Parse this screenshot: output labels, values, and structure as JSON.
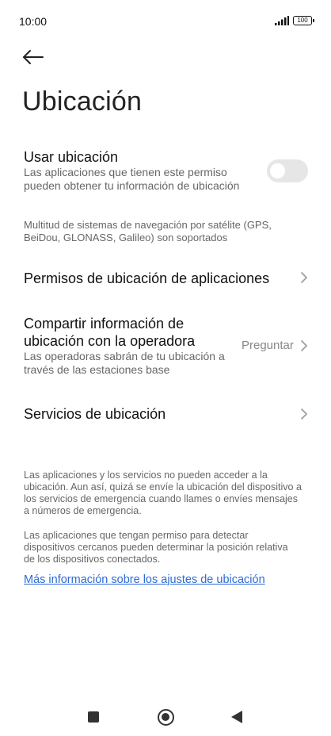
{
  "status_bar": {
    "time": "10:00",
    "battery": "100",
    "icons": [
      "signal-icon",
      "battery-icon"
    ]
  },
  "header": {
    "back_icon": "arrow-left-icon",
    "title": "Ubicación"
  },
  "use_location": {
    "title": "Usar ubicación",
    "subtitle_line1": "Las aplicaciones que tienen este permiso",
    "subtitle_line2": "pueden obtener tu información de ubicación",
    "enabled": false
  },
  "gnss_note": {
    "line1": "Multitud de sistemas de navegación por satélite (GPS,",
    "line2": "BeiDou, GLONASS, Galileo) son soportados"
  },
  "app_permissions": {
    "title": "Permisos de ubicación de aplicaciones"
  },
  "carrier_sharing": {
    "title_line1": "Compartir información de",
    "title_line2": "ubicación con la operadora",
    "subtitle_line1": "Las operadoras sabrán de tu ubicación a",
    "subtitle_line2": "través de las estaciones base",
    "value": "Preguntar"
  },
  "location_services": {
    "title": "Servicios de ubicación"
  },
  "footer_note1": {
    "line1": "Las aplicaciones y los servicios no pueden acceder a la",
    "line2": "ubicación. Aun así, quizá se envíe la ubicación del dispositivo a",
    "line3": "los servicios de emergencia cuando llames o envíes mensajes",
    "line4": "a números de emergencia."
  },
  "footer_note2": {
    "line1": "Las aplicaciones que tengan permiso para detectar",
    "line2": "dispositivos cercanos pueden determinar la posición relativa",
    "line3": "de los dispositivos conectados."
  },
  "more_info_link": "Más información sobre los ajustes de ubicación",
  "nav_bar": {
    "icons": [
      "recents-square-icon",
      "home-circle-icon",
      "back-triangle-icon"
    ]
  },
  "colors": {
    "link": "#2f6bd6",
    "toggle_off": "#e6e6e6",
    "secondary_text": "#666666"
  }
}
